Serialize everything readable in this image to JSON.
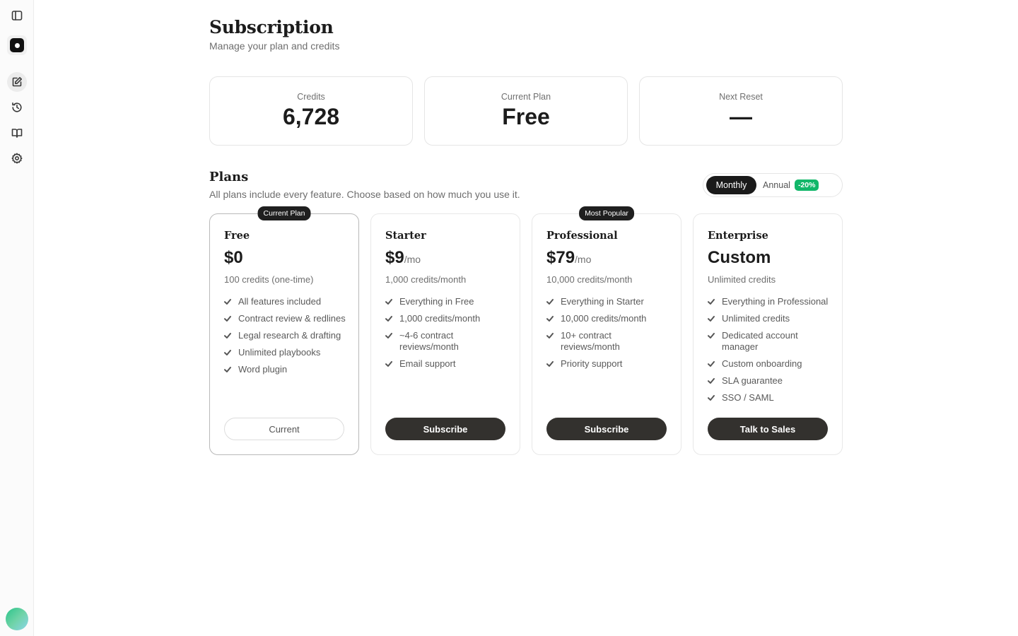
{
  "sidebar": {
    "icons": [
      "sidebar-toggle-icon",
      "logo-icon",
      "new-chat-icon",
      "history-icon",
      "book-icon",
      "gear-icon"
    ]
  },
  "header": {
    "title": "Subscription",
    "subtitle": "Manage your plan and credits"
  },
  "stats": [
    {
      "label": "Credits",
      "value": "6,728"
    },
    {
      "label": "Current Plan",
      "value": "Free"
    },
    {
      "label": "Next Reset",
      "value": "—"
    }
  ],
  "plans_section": {
    "title": "Plans",
    "subtitle": "All plans include every feature. Choose based on how much you use it.",
    "toggle": {
      "monthly": "Monthly",
      "annual": "Annual",
      "discount": "-20%",
      "selected": "Monthly"
    }
  },
  "plans": [
    {
      "badge": "Current Plan",
      "name": "Free",
      "price": "$0",
      "period": "",
      "credits": "100 credits (one-time)",
      "features": [
        "All features included",
        "Contract review & redlines",
        "Legal research & drafting",
        "Unlimited playbooks",
        "Word plugin"
      ],
      "button": "Current"
    },
    {
      "badge": "",
      "name": "Starter",
      "price": "$9",
      "period": "/mo",
      "credits": "1,000 credits/month",
      "features": [
        "Everything in Free",
        "1,000 credits/month",
        "~4-6 contract reviews/month",
        "Email support"
      ],
      "button": "Subscribe"
    },
    {
      "badge": "Most Popular",
      "name": "Professional",
      "price": "$79",
      "period": "/mo",
      "credits": "10,000 credits/month",
      "features": [
        "Everything in Starter",
        "10,000 credits/month",
        "10+ contract reviews/month",
        "Priority support"
      ],
      "button": "Subscribe"
    },
    {
      "badge": "",
      "name": "Enterprise",
      "price": "Custom",
      "period": "",
      "credits": "Unlimited credits",
      "features": [
        "Everything in Professional",
        "Unlimited credits",
        "Dedicated account manager",
        "Custom onboarding",
        "SLA guarantee",
        "SSO / SAML"
      ],
      "button": "Talk to Sales"
    }
  ],
  "colors": {
    "accent_dark": "#1a1a1a",
    "button_dark": "#33312e",
    "discount_green": "#12b76a",
    "muted_text": "#6e6e6e"
  }
}
